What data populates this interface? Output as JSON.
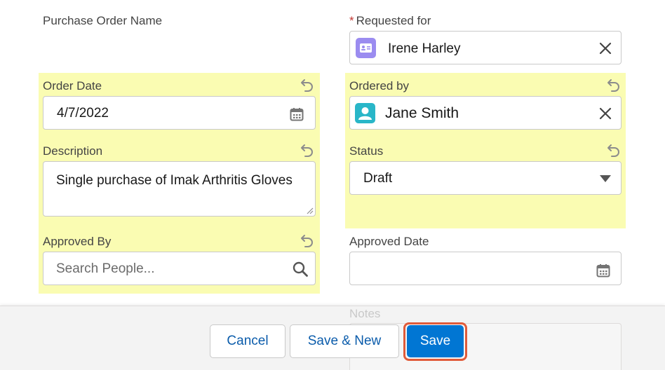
{
  "form": {
    "purchase_order_name": {
      "label": "Purchase Order Name"
    },
    "requested_for": {
      "required_marker": "*",
      "label": "Requested for",
      "value": "Irene Harley",
      "icon": "contact-card-icon"
    },
    "order_date": {
      "label": "Order Date",
      "value": "4/7/2022",
      "icon": "calendar-icon"
    },
    "ordered_by": {
      "label": "Ordered by",
      "value": "Jane Smith",
      "icon": "user-avatar-icon"
    },
    "description": {
      "label": "Description",
      "value": "Single purchase of Imak Arthritis Gloves"
    },
    "status": {
      "label": "Status",
      "value": "Draft"
    },
    "approved_by": {
      "label": "Approved By",
      "placeholder": "Search People...",
      "icon": "search-icon"
    },
    "approved_date": {
      "label": "Approved Date",
      "value": "",
      "icon": "calendar-icon"
    },
    "notes": {
      "label": "Notes"
    }
  },
  "footer": {
    "cancel_label": "Cancel",
    "save_new_label": "Save & New",
    "save_label": "Save"
  },
  "colors": {
    "highlight": "#fafcb2",
    "brand": "#0176d3",
    "focus_outline": "#e05b3a",
    "contact_icon": "#9b8cf0",
    "user_icon": "#29b6c8"
  }
}
